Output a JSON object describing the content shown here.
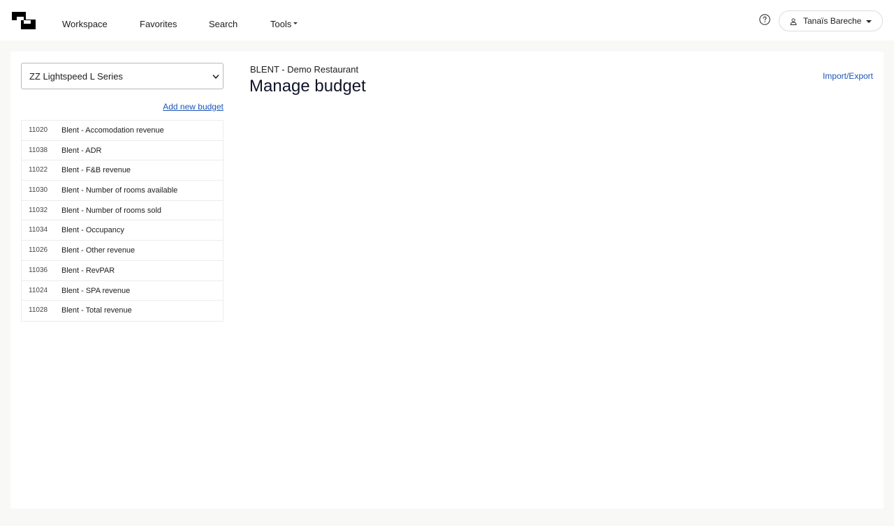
{
  "nav": {
    "items": [
      {
        "label": "Workspace"
      },
      {
        "label": "Favorites"
      },
      {
        "label": "Search"
      },
      {
        "label": "Tools"
      }
    ],
    "icons": {
      "logo": "app-logo",
      "help": "help-circle-icon",
      "user": "user-icon",
      "dropdown": "caret-down-icon"
    }
  },
  "user": {
    "name": "Tanaïs Bareche"
  },
  "sidebar": {
    "select_value": "ZZ Lightspeed L Series",
    "add_link": "Add new budget",
    "budgets": [
      {
        "code": "11020",
        "name": "Blent - Accomodation revenue"
      },
      {
        "code": "11038",
        "name": "Blent - ADR"
      },
      {
        "code": "11022",
        "name": "Blent - F&B revenue"
      },
      {
        "code": "11030",
        "name": "Blent - Number of rooms available"
      },
      {
        "code": "11032",
        "name": "Blent - Number of rooms sold"
      },
      {
        "code": "11034",
        "name": "Blent - Occupancy"
      },
      {
        "code": "11026",
        "name": "Blent - Other revenue"
      },
      {
        "code": "11036",
        "name": "Blent - RevPAR"
      },
      {
        "code": "11024",
        "name": "Blent - SPA revenue"
      },
      {
        "code": "11028",
        "name": "Blent - Total revenue"
      }
    ]
  },
  "main": {
    "org_name": "BLENT - Demo Restaurant",
    "title": "Manage budget",
    "import_export": "Import/Export"
  },
  "colors": {
    "link": "#1a55b8",
    "background": "#f8f8f6",
    "title": "#10142a"
  }
}
